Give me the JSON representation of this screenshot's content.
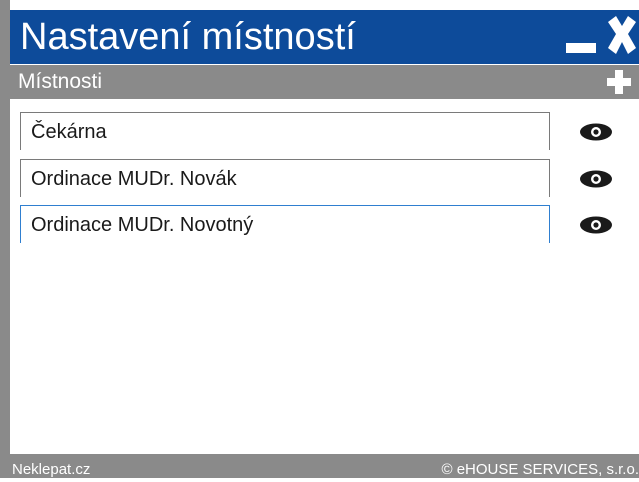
{
  "window": {
    "title": "Nastavení místností",
    "accent_color": "#0d4b9a",
    "bar_color": "#8a8a8a"
  },
  "titlebar": {
    "minimize_icon": "minimize-icon",
    "close_icon": "close-icon"
  },
  "section": {
    "title": "Místnosti",
    "add_icon": "plus-icon"
  },
  "rooms": [
    {
      "name": "Čekárna",
      "visibility_icon": "eye-icon"
    },
    {
      "name": "Ordinace MUDr. Novák",
      "visibility_icon": "eye-icon"
    },
    {
      "name": "Ordinace MUDr. Novotný",
      "visibility_icon": "eye-icon",
      "focused": true
    }
  ],
  "footer": {
    "left": "Neklepat.cz",
    "right": "© eHOUSE SERVICES, s.r.o."
  }
}
